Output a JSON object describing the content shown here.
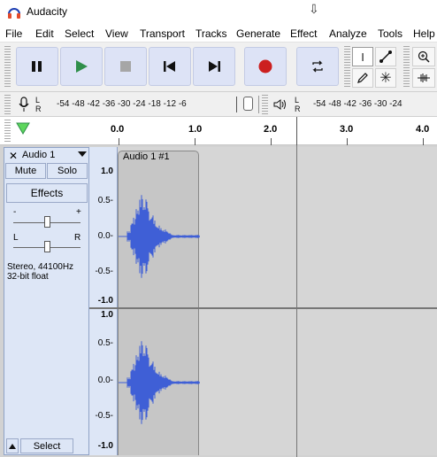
{
  "window": {
    "title": "Audacity",
    "app_icon": "headphones-icon"
  },
  "menu": [
    "File",
    "Edit",
    "Select",
    "View",
    "Transport",
    "Tracks",
    "Generate",
    "Effect",
    "Analyze",
    "Tools",
    "Help"
  ],
  "transport": {
    "pause": "pause-icon",
    "play": "play-icon",
    "stop": "stop-icon",
    "skip_start": "skip-to-start-icon",
    "skip_end": "skip-to-end-icon",
    "record": "record-icon",
    "loop": "loop-icon"
  },
  "tools": [
    "selection-tool",
    "envelope-tool",
    "draw-tool",
    "multi-tool",
    "zoom-in",
    "trim-audio"
  ],
  "meters": {
    "record_scale": "-54  -48  -42  -36  -30  -24  -18  -12   -6",
    "playback_scale": "-54  -48  -42  -36  -30  -24",
    "left_channel": "L",
    "right_channel": "R"
  },
  "timeline": {
    "ticks": [
      "0.0",
      "1.0",
      "2.0",
      "3.0",
      "4.0"
    ]
  },
  "track": {
    "name": "Audio 1",
    "mute": "Mute",
    "solo": "Solo",
    "effects": "Effects",
    "gain_minus": "-",
    "gain_plus": "+",
    "pan_left": "L",
    "pan_right": "R",
    "info_line1": "Stereo, 44100Hz",
    "info_line2": "32-bit float",
    "select": "Select",
    "clip_name": "Audio 1 #1",
    "channel1_scale": [
      "1.0",
      "0.5-",
      "0.0-",
      "-0.5-",
      "-1.0"
    ],
    "channel2_scale": [
      "1.0",
      "0.5-",
      "0.0-",
      "-0.5-",
      "-1.0"
    ]
  },
  "colors": {
    "waveform": "#3f5fd6",
    "record_red": "#cc1f1f",
    "play_green": "#2f8f4a",
    "transport_bg": "#dde3f6"
  }
}
